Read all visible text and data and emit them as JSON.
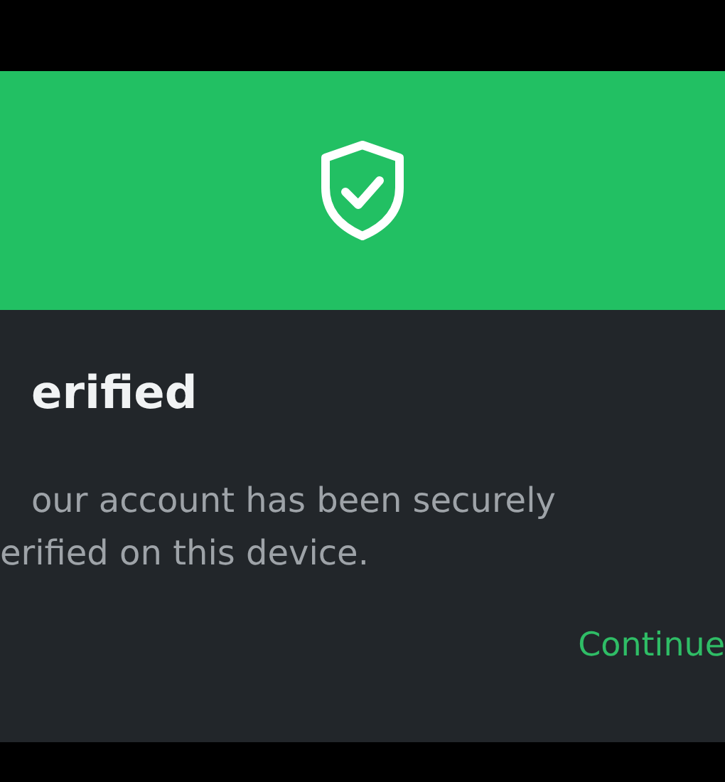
{
  "dialog": {
    "title": "erified",
    "message_lines": [
      "our account has been securely",
      "erified on this device."
    ],
    "actions": [
      {
        "label": "Continue"
      }
    ]
  }
}
